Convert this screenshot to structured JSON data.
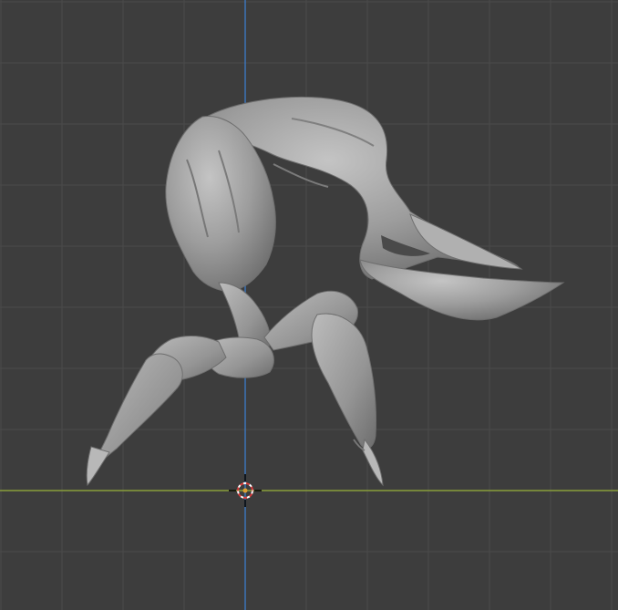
{
  "viewport": {
    "background_color": "#3d3d3d",
    "grid_minor_color": "#454545",
    "grid_major_color": "#4a4a4a",
    "x_axis_color": "#8a9e3b",
    "z_axis_color": "#3d74b8",
    "mesh_color": "#9b9b9b",
    "mesh_shadow_color": "#6e6e6e",
    "mesh_highlight_color": "#c2c2c2"
  },
  "scene": {
    "object": "sculpted-creature-mesh",
    "cursor_icon": "3d-cursor-icon"
  }
}
